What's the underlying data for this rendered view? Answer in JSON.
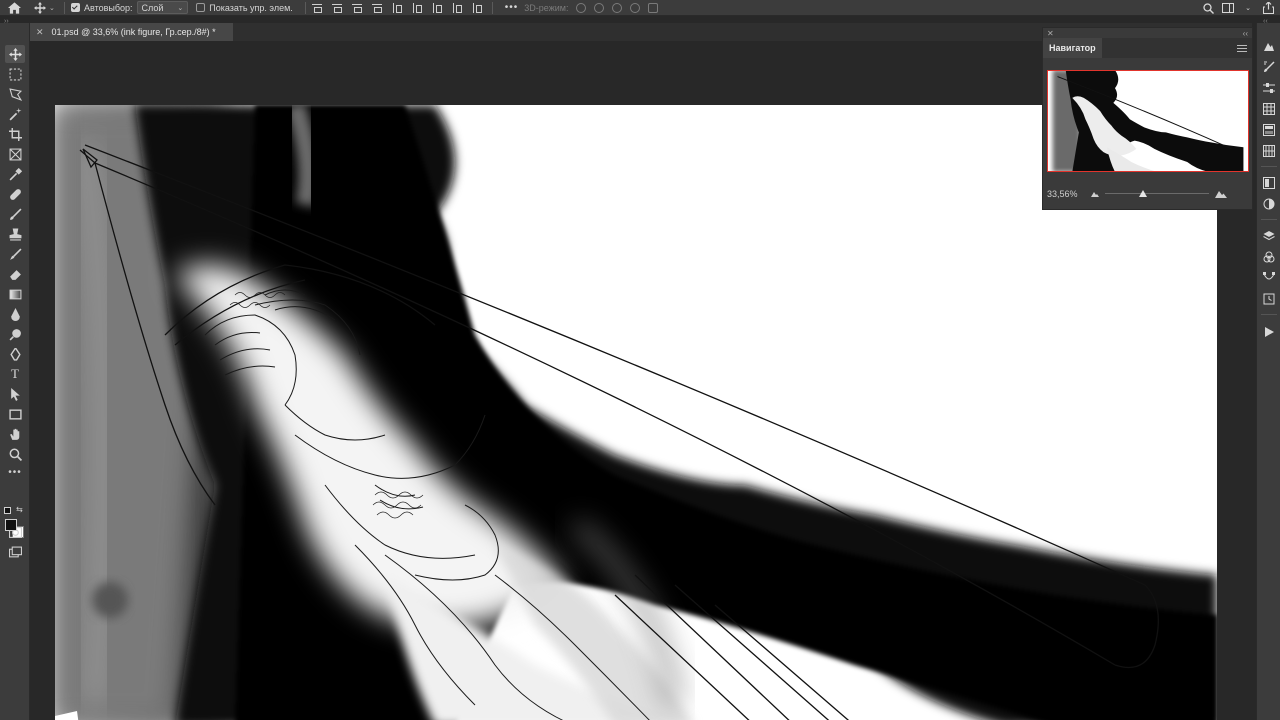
{
  "app": {
    "name": "Photoshop"
  },
  "options_bar": {
    "auto_select_label": "Автовыбор:",
    "auto_select_checked": true,
    "auto_select_value": "Слой",
    "show_transform_label": "Показать упр. элем.",
    "show_transform_checked": false,
    "more_label": "•••",
    "mode_3d_label": "3D-режим:"
  },
  "document": {
    "tab_title": "01.psd @ 33,6% (ink figure, Гр.сер./8#) *"
  },
  "navigator": {
    "panel_title": "Навигатор",
    "zoom_value": "33,56%",
    "zoom_slider_fraction": 0.37
  },
  "colors": {
    "foreground": "#111111",
    "background": "#ffffff",
    "view_box": "#e2342c"
  },
  "icons": {
    "home": "home-icon",
    "move": "move-icon",
    "search": "search-icon",
    "workspace": "workspace-icon",
    "share": "share-icon"
  }
}
